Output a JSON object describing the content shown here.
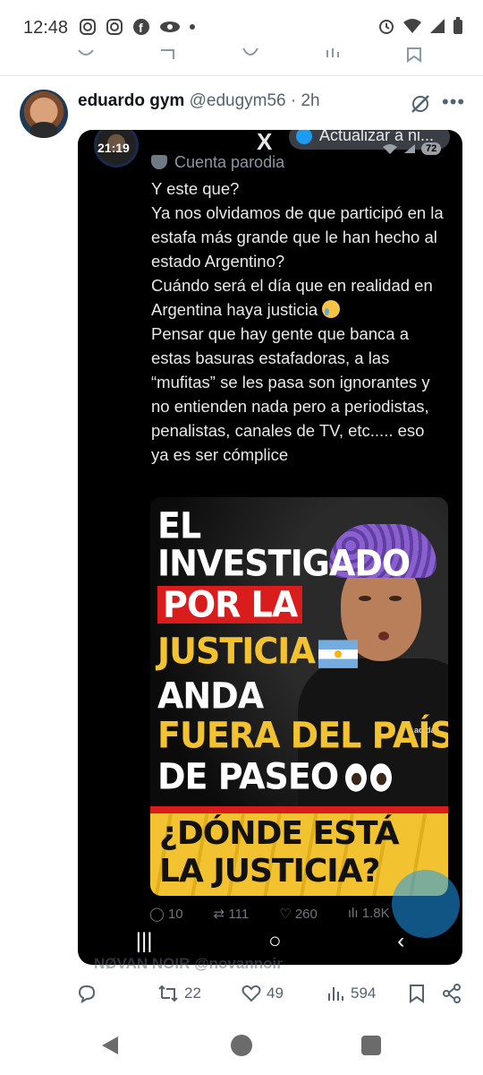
{
  "status_bar": {
    "time": "12:48",
    "left_icons": [
      "instagram-icon",
      "instagram-icon",
      "facebook-icon",
      "reading-glasses-icon",
      "dot-icon"
    ],
    "right_icons": [
      "alarm-icon",
      "wifi-icon",
      "signal-icon",
      "battery-icon"
    ]
  },
  "tweet": {
    "author_name": "eduardo gym",
    "author_handle": "@edugym56 · 2h",
    "actions": {
      "reply": "",
      "retweets": "22",
      "likes": "49",
      "views": "594"
    }
  },
  "embedded_screenshot": {
    "time": "21:19",
    "battery": "72",
    "update_pill": "Actualizar a ni...",
    "parody_label": "Cuenta parodia",
    "text": "Y este que?\nYa nos olvidamos de que participó en la estafa más grande que le han hecho al estado Argentino?\nCuándo será el día que en realidad en Argentina haya justicia ",
    "text_after_emoji": "\nPensar que hay gente que banca a estas basuras estafadoras, a las “mufitas” se les pasa son ignorantes y no entienden nada pero a periodistas, penalistas, canales de TV, etc..... eso ya es ser cómplice",
    "poster": {
      "line1": "EL",
      "line2": "INVESTIGADO",
      "line3": "POR LA",
      "line4": "JUSTICIA",
      "line5": "ANDA",
      "line6": "FUERA DEL PAÍS",
      "line7": "DE PASEO",
      "banner1": "¿DÓNDE ESTÁ",
      "banner2": "LA JUSTICIA?",
      "shirt_brand": "adidas"
    },
    "actions": {
      "reply": "10",
      "retweets": "111",
      "likes": "260",
      "views": "1.8K"
    },
    "nav": [
      "|||",
      "○",
      "‹"
    ]
  },
  "next_tweet_peek": "NØVAN NOIR  @novannoir",
  "colors": {
    "accent": "#1d9bf0",
    "poster_yellow": "#f2c230",
    "poster_red": "#d91d1d"
  }
}
